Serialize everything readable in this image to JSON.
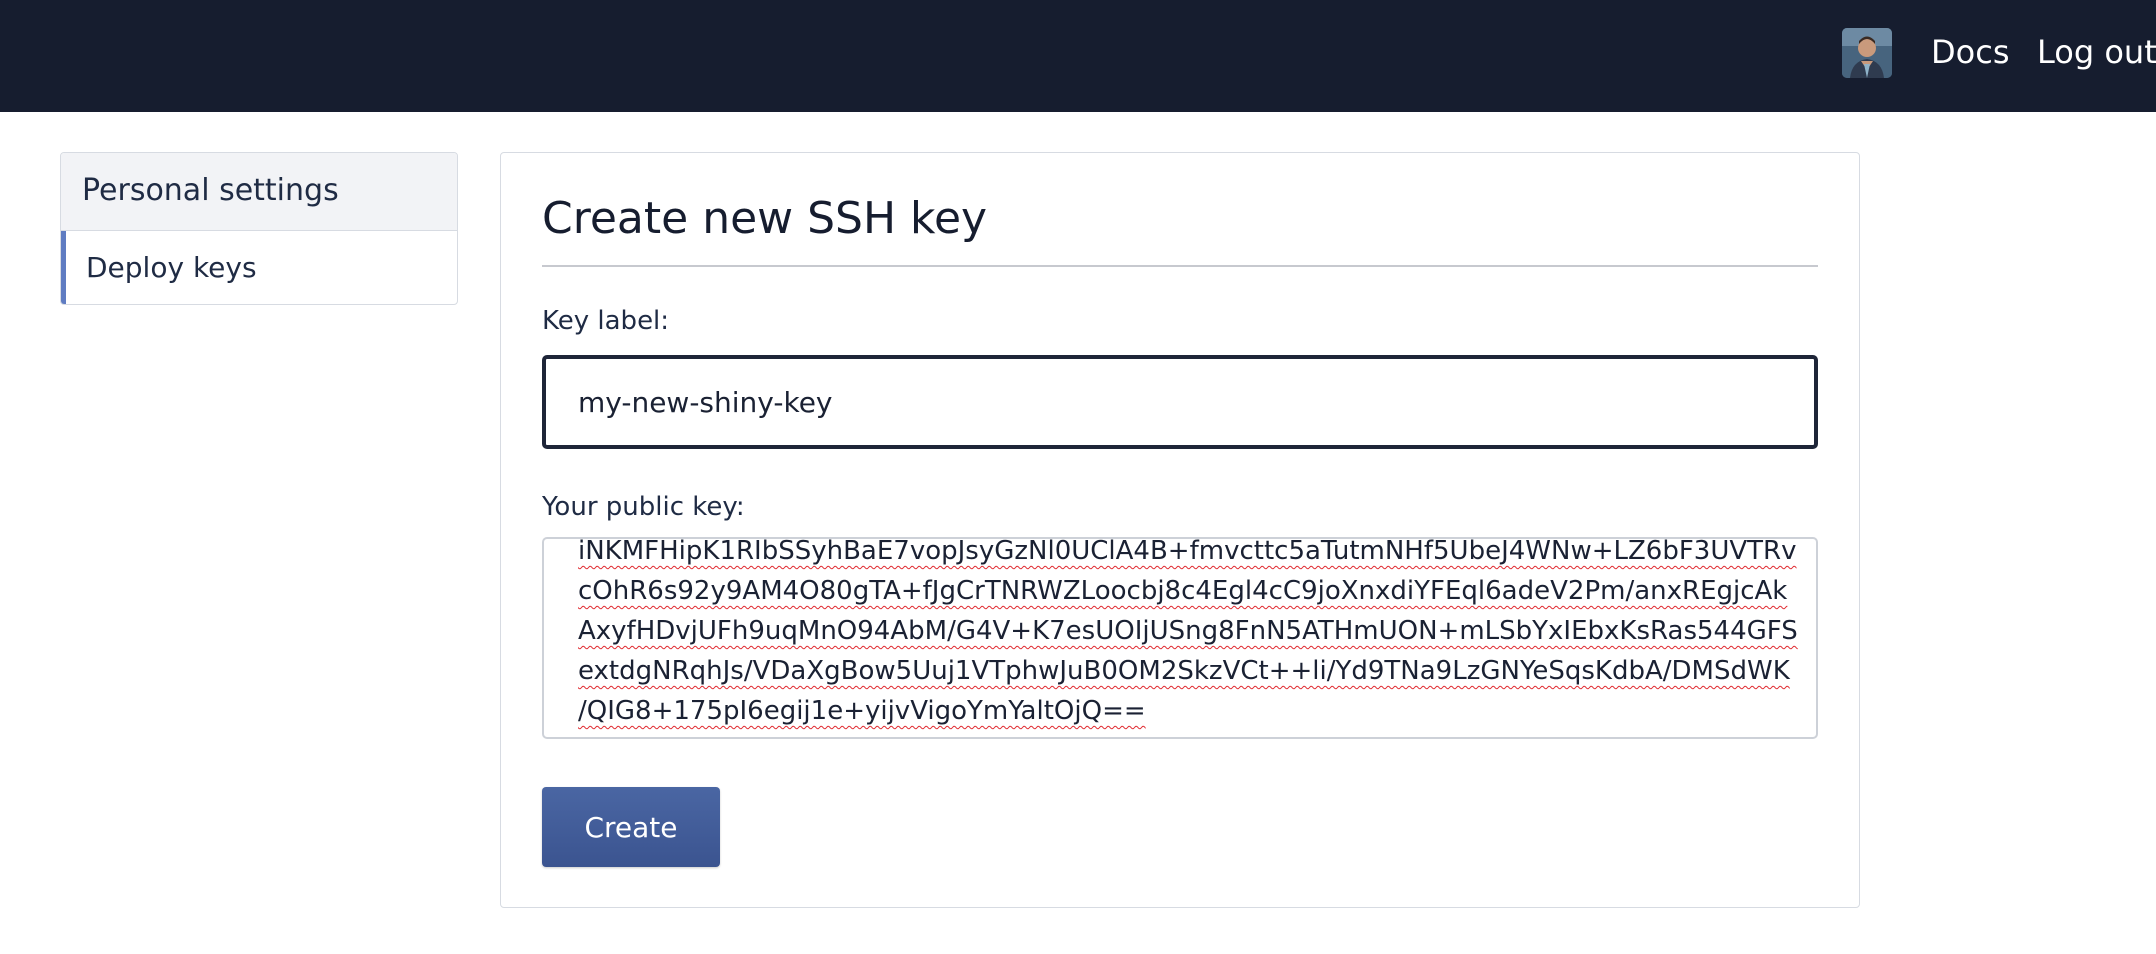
{
  "header": {
    "avatar_icon": "user-avatar",
    "docs_label": "Docs",
    "logout_label": "Log out"
  },
  "sidebar": {
    "title": "Personal settings",
    "items": [
      {
        "label": "Deploy keys",
        "active": true
      }
    ]
  },
  "form": {
    "title": "Create new SSH key",
    "key_label": "Key label:",
    "key_value": "my-new-shiny-key",
    "public_key_label": "Your public key:",
    "public_key_lines": [
      "iNKMFHipK1RIbSSyhBaE7vopJsyGzNl0UClA4B+fmvcttc5aTutmNHf5UbeJ4WNw+LZ6bF3UVTRv",
      "cOhR6s92y9AM4O80gTA+fJgCrTNRWZLoocbj8c4Egl4cC9joXnxdiYFEql6adeV2Pm/anxREgjcAk",
      "AxyfHDvjUFh9uqMnO94AbM/G4V+K7esUOIjUSng8FnN5ATHmUON+mLSbYxIEbxKsRas544GFS",
      "extdgNRqhJs/VDaXgBow5Uuj1VTphwJuB0OM2SkzVCt++li/Yd9TNa9LzGNYeSqsKdbA/DMSdWK",
      "/QIG8+175pI6egij1e+yijvVigoYmYaltOjQ=="
    ],
    "create_label": "Create"
  },
  "colors": {
    "topbar": "#161d2f",
    "sidebar_accent": "#5f7cc2",
    "button": "#3b5490",
    "spellcheck": "#e0282e"
  }
}
